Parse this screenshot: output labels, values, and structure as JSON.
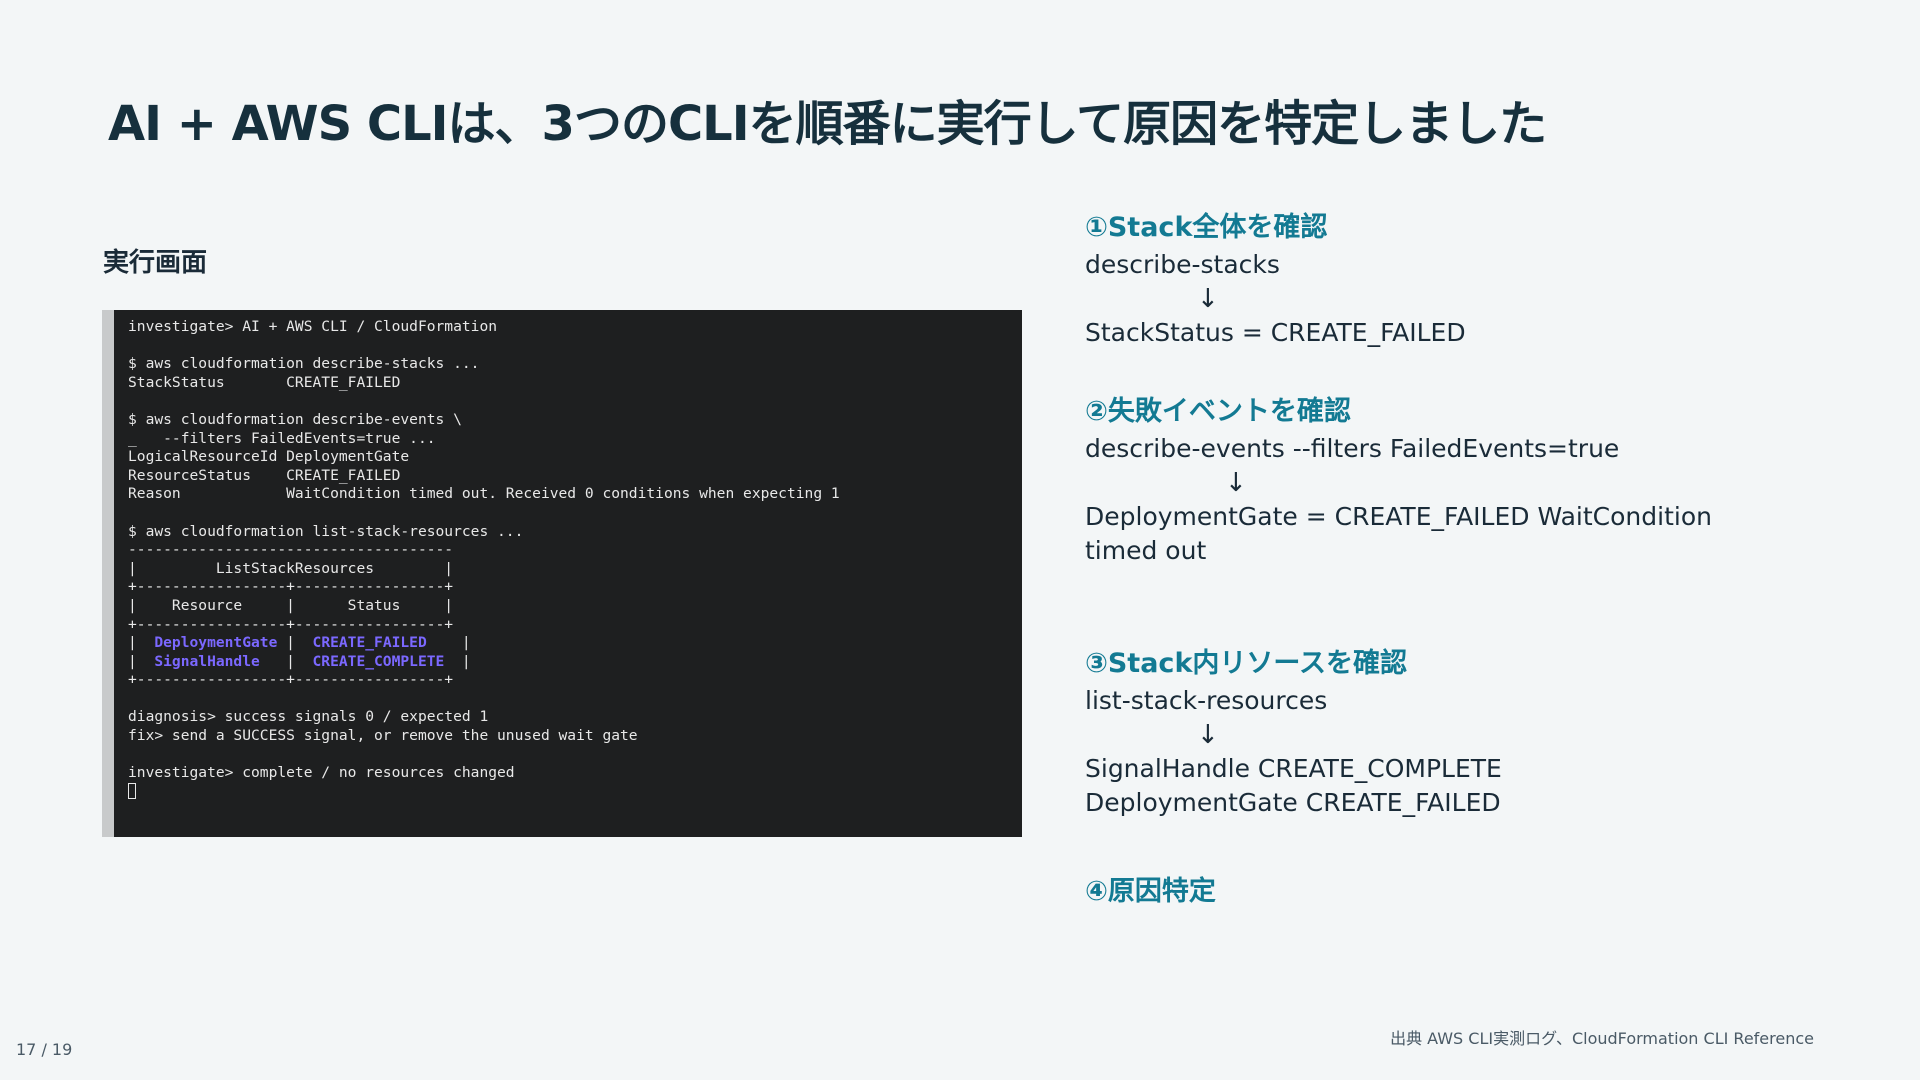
{
  "slide": {
    "title": "AI + AWS CLIは、3つのCLIを順番に実行して原因を特定しました",
    "section_label": "実行画面",
    "page_number": "17 / 19",
    "source": "出典 AWS CLI実測ログ、CloudFormation CLI Reference"
  },
  "terminal": {
    "lines": [
      "investigate> AI + AWS CLI / CloudFormation",
      "",
      "$ aws cloudformation describe-stacks ...",
      "StackStatus       CREATE_FAILED",
      "",
      "$ aws cloudformation describe-events \\",
      "_   --filters FailedEvents=true ...",
      "LogicalResourceId DeploymentGate",
      "ResourceStatus    CREATE_FAILED",
      "Reason            WaitCondition timed out. Received 0 conditions when expecting 1",
      "",
      "$ aws cloudformation list-stack-resources ...",
      "-------------------------------------",
      "|         ListStackResources        |",
      "+-----------------+-----------------+",
      "|    Resource     |      Status     |",
      "+-----------------+-----------------+"
    ],
    "table_rows": [
      {
        "resource": "DeploymentGate",
        "status": "CREATE_FAILED"
      },
      {
        "resource": "SignalHandle",
        "status": "CREATE_COMPLETE"
      }
    ],
    "table_bottom": "+-----------------+-----------------+",
    "after_lines": [
      "",
      "diagnosis> success signals 0 / expected 1",
      "fix> send a SUCCESS signal, or remove the unused wait gate",
      "",
      "investigate> complete / no resources changed"
    ]
  },
  "steps": [
    {
      "title": "①Stack全体を確認",
      "command": "describe-stacks",
      "arrow": "↓",
      "result": "StackStatus = CREATE_FAILED"
    },
    {
      "title": "②失敗イベントを確認",
      "command": "describe-events --filters FailedEvents=true",
      "arrow": "↓",
      "result": "DeploymentGate = CREATE_FAILED WaitCondition timed out"
    },
    {
      "title": "③Stack内リソースを確認",
      "command": "list-stack-resources",
      "arrow": "↓",
      "result": "SignalHandle CREATE_COMPLETE DeploymentGate CREATE_FAILED"
    },
    {
      "title": "④原因特定"
    }
  ]
}
